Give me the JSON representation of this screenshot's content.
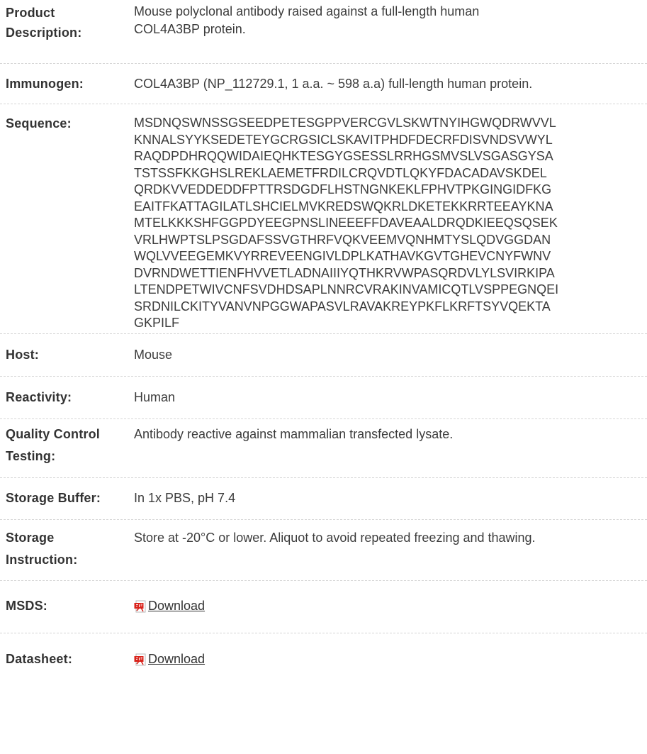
{
  "rows": {
    "product_description": {
      "label_line1": "Product",
      "label_line2": "Description:",
      "value_line1": "Mouse polyclonal antibody raised against a full-length human",
      "value_line2": "COL4A3BP protein."
    },
    "immunogen": {
      "label": "Immunogen:",
      "value": "COL4A3BP (NP_112729.1, 1 a.a. ~ 598 a.a) full-length human protein."
    },
    "sequence": {
      "label": "Sequence:",
      "lines": [
        "MSDNQSWNSSGSEEDPETESGPPVERCGVLSKWTNYIHGWQDRWVVL",
        "KNNALSYYKSEDETEYGCRGSICLSKAVITPHDFDECRFDISVNDSVWYL",
        "RAQDPDHRQQWIDAIEQHKTESGYGSESSLRRHGSMVSLVSGASGYSA",
        "TSTSSFKKGHSLREKLAEMETFRDILCRQVDTLQKYFDACADAVSKDEL",
        "QRDKVVEDDEDDFPTTRSDGDFLHSTNGNKEKLFPHVTPKGINGIDFKG",
        "EAITFKATTAGILATLSHCIELMVKREDSWQKRLDKETEKKRRTEEAYKNA",
        "MTELKKKSHFGGPDYEEGPNSLINEEEFFDAVEAALDRQDKIEEQSQSEK",
        "VRLHWPTSLPSGDAFSSVGTHRFVQKVEEMVQNHMTYSLQDVGGDAN",
        "WQLVVEEGEMKVYRREVEENGIVLDPLKATHAVKGVTGHEVCNYFWNV",
        "DVRNDWETTIENFHVVETLADNAIIIYQTHKRVWPASQRDVLYLSVIRKIPA",
        "LTENDPETWIVCNFSVDHDSAPLNNRCVRAKINVAMICQTLVSPPEGNQEI",
        "SRDNILCKITYVANVNPGGWAPASVLRAVAKREYPKFLKRFTSYVQEKTA",
        "GKPILF"
      ]
    },
    "host": {
      "label": "Host:",
      "value": "Mouse"
    },
    "reactivity": {
      "label": "Reactivity:",
      "value": "Human"
    },
    "quality_control": {
      "label_line1": "Quality Control",
      "label_line2": "Testing:",
      "value": "Antibody reactive against mammalian transfected lysate."
    },
    "storage_buffer": {
      "label": "Storage Buffer:",
      "value": "In 1x PBS, pH 7.4"
    },
    "storage_instruction": {
      "label_line1": "Storage",
      "label_line2": "Instruction:",
      "value": "Store at -20°C or lower. Aliquot to avoid repeated freezing and thawing."
    },
    "msds": {
      "label": "MSDS:",
      "link_text": "Download",
      "icon": "pdf-icon"
    },
    "datasheet": {
      "label": "Datasheet:",
      "link_text": "Download",
      "icon": "pdf-icon"
    }
  },
  "colors": {
    "label": "#333333",
    "text": "#3c3c3c",
    "divider": "#d6d6d6",
    "pdf_red": "#d9241c"
  }
}
